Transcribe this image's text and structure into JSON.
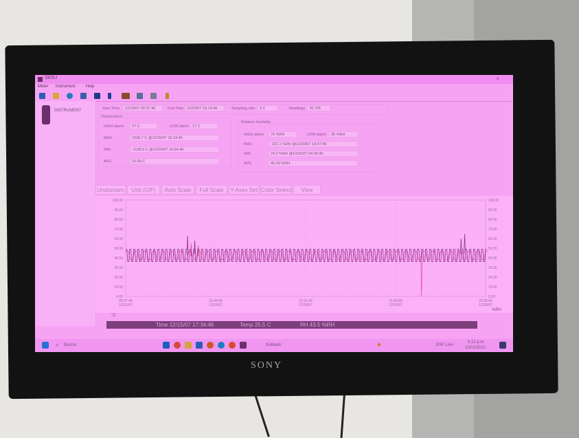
{
  "monitor": {
    "brand": "SONY"
  },
  "window": {
    "title": "SK5U"
  },
  "menu": {
    "items": [
      "Meter",
      "Instrument",
      "Help"
    ]
  },
  "toolbar": {
    "icons": [
      "save-icon",
      "open-icon",
      "download-icon",
      "grid-icon",
      "table-icon",
      "battery-icon",
      "card-icon",
      "layout-icon",
      "print-icon",
      "help-icon"
    ]
  },
  "sidebar": {
    "instrument_label": "INSTRUMENT"
  },
  "time_range": {
    "start_label": "Start Time",
    "start_value": "12/15/07 00:37:46",
    "end_label": "End Time",
    "end_value": "12/20/07 16:19:46",
    "sampling_label": "Sampling rate",
    "sampling_value": "5:2",
    "readings_label": "Readings",
    "readings_value": "78,726"
  },
  "temperature": {
    "section_label": "Temperature",
    "high_alarm_label": "HIGH alarm",
    "high_alarm_value": "27 C",
    "low_alarm_label": "LOW alarm",
    "low_alarm_value": "17 C",
    "max_label": "MAX",
    "max_value": "1538.7 C @12/20/07 16:19:46",
    "min_label": "MIN",
    "min_value": "-1138.5 C @12/20/07 16:54:46",
    "avg_label": "AVG",
    "avg_value": "10.89 C"
  },
  "humidity": {
    "section_label": "Relative Humidity",
    "high_alarm_label": "HIGH alarm",
    "high_alarm_value": "70 %RH",
    "low_alarm_label": "LOW alarm",
    "low_alarm_value": "35 %RH",
    "max_label": "MAX",
    "max_value": "-101.1 %RH @12/20/07 16:37:46",
    "min_label": "MIN",
    "min_value": "24.2 %RH @12/15/07 04:25:46",
    "avg_label": "AVG",
    "avg_value": "40.29 %RH"
  },
  "chart_buttons": [
    "Undozoom",
    "Unit (C/F)",
    "Auto Scale",
    "Full Scale",
    "Y-Axes Set",
    "Color Select",
    "View"
  ],
  "chart_data": {
    "type": "line",
    "ylim": [
      0,
      100
    ],
    "y_ticks": [
      "100.00",
      "90.00",
      "80.00",
      "70.00",
      "60.00",
      "50.00",
      "40.00",
      "30.00",
      "20.00",
      "10.00",
      "0.00"
    ],
    "x_ticks": [
      {
        "time": "09:37:46",
        "date": "12/15/07"
      },
      {
        "time": "21:44:46",
        "date": "12/16/07"
      },
      {
        "time": "21:51:46",
        "date": "12/18/07"
      },
      {
        "time": "21:58:46",
        "date": "12/19/07"
      },
      {
        "time": "22:05:46",
        "date": "12/20/07"
      }
    ],
    "unit_left": "°C",
    "unit_right": "%RH",
    "series": [
      {
        "color": "#7a1f7a",
        "baseline": 44,
        "high": 49,
        "low": 36,
        "cycles": 90,
        "spikes": [
          [
            0.17,
            63
          ],
          [
            0.19,
            58
          ],
          [
            0.93,
            60
          ],
          [
            0.94,
            65
          ]
        ]
      },
      {
        "color": "#c0145a",
        "baseline": 42,
        "high": 47,
        "low": 38,
        "cycles": 40,
        "spikes": [
          [
            0.18,
            55
          ],
          [
            0.2,
            53
          ],
          [
            0.82,
            0
          ]
        ]
      }
    ]
  },
  "status": {
    "time": "Time 12/15/07 17:34:46",
    "temp": "Temp 25.5 C",
    "rh": "RH 43.5 %RH"
  },
  "taskbar": {
    "search_placeholder": "Buscar",
    "weather": "Nublado",
    "clock_time": "5:21 p.m.",
    "clock_date": "10/01/2022",
    "lang": "ESP LAA"
  }
}
